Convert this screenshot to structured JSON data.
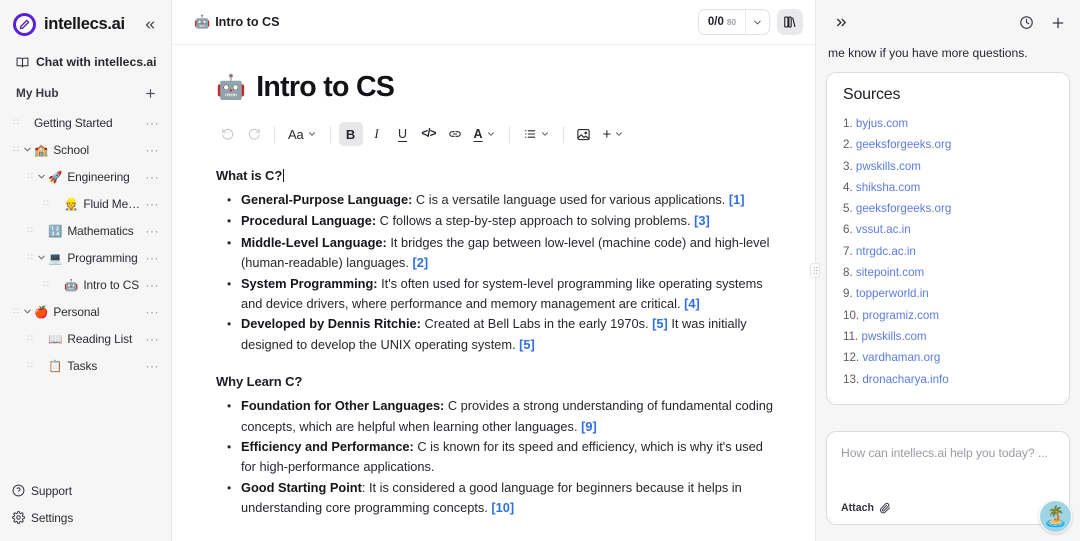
{
  "brand": {
    "name": "intellecs.ai",
    "accent": "#5b21d6",
    "logo_icon": "pen-circle-icon"
  },
  "sidebar": {
    "collapse_icon": "chevrons-left-icon",
    "chat_entry": {
      "label": "Chat with intellecs.ai",
      "icon": "book-open-icon"
    },
    "hub": {
      "label": "My Hub",
      "add_icon": "plus-icon"
    },
    "more_glyph": "···",
    "grip_glyph": "∷",
    "items": [
      {
        "label": "Getting Started",
        "emoji": "",
        "indent": 0,
        "caret": "none"
      },
      {
        "label": "School",
        "emoji": "🏫",
        "indent": 0,
        "caret": "down"
      },
      {
        "label": "Engineering",
        "emoji": "🚀",
        "indent": 1,
        "caret": "down"
      },
      {
        "label": "Fluid Mech...",
        "emoji": "👷",
        "indent": 2,
        "caret": "none"
      },
      {
        "label": "Mathematics",
        "emoji": "🔢",
        "indent": 1,
        "caret": "none"
      },
      {
        "label": "Programming",
        "emoji": "💻",
        "indent": 1,
        "caret": "down"
      },
      {
        "label": "Intro to CS",
        "emoji": "🤖",
        "indent": 2,
        "caret": "none"
      },
      {
        "label": "Personal",
        "emoji": "🍎",
        "indent": 0,
        "caret": "down"
      },
      {
        "label": "Reading List",
        "emoji": "📖",
        "indent": 1,
        "caret": "none"
      },
      {
        "label": "Tasks",
        "emoji": "📋",
        "indent": 1,
        "caret": "none"
      }
    ],
    "bottom": [
      {
        "label": "Support",
        "icon": "help-circle-icon"
      },
      {
        "label": "Settings",
        "icon": "gear-icon"
      }
    ]
  },
  "editor": {
    "breadcrumb": {
      "emoji": "🤖",
      "label": "Intro to CS"
    },
    "count_pill": {
      "value": "0/0",
      "sub": "80",
      "caret_icon": "chevron-down-icon"
    },
    "library_icon": "library-books-icon",
    "doc": {
      "emoji": "🤖",
      "title": "Intro to CS",
      "sections": [
        {
          "heading": "What is C?",
          "cursor": true,
          "bullets": [
            {
              "term": "General-Purpose Language:",
              "text": " C is a versatile language used for various applications. ",
              "cites": [
                "[1]"
              ]
            },
            {
              "term": "Procedural Language:",
              "text": " C follows a step-by-step approach to solving problems. ",
              "cites": [
                "[3]"
              ]
            },
            {
              "term": "Middle-Level Language:",
              "text": " It bridges the gap between low-level (machine code) and high-level (human-readable) languages. ",
              "cites": [
                "[2]"
              ]
            },
            {
              "term": "System Programming:",
              "text": " It's often used for system-level programming like operating systems and device drivers, where performance and memory management are critical. ",
              "cites": [
                "[4]"
              ]
            },
            {
              "term": "Developed by Dennis Ritchie:",
              "text": " Created at Bell Labs in the early 1970s. ",
              "cites": [
                "[5]"
              ],
              "text2": " It was initially designed to develop the UNIX operating system. ",
              "cites2": [
                "[5]"
              ]
            }
          ]
        },
        {
          "heading": "Why Learn C?",
          "cursor": false,
          "bullets": [
            {
              "term": "Foundation for Other Languages:",
              "text": " C provides a strong understanding of fundamental coding concepts, which are helpful when learning other languages. ",
              "cites": [
                "[9]"
              ]
            },
            {
              "term": "Efficiency and Performance:",
              "text": " C is known for its speed and efficiency, which is why it's used for high-performance applications.",
              "cites": []
            },
            {
              "term": "Good Starting Point",
              "text": ": It is considered a good language for beginners because it helps in understanding core programming concepts. ",
              "cites": [
                "[10]"
              ]
            }
          ]
        }
      ]
    },
    "toolbar": {
      "undo_label": "undo-icon",
      "redo_label": "redo-icon",
      "font_label": "Aa",
      "bold_label": "B",
      "italic_label": "I",
      "underline_label": "U",
      "code_label": "</>",
      "link_label": "link-icon",
      "color_label": "A",
      "list_label": "list-icon",
      "image_label": "image-icon",
      "plus_label": "+"
    },
    "resizer_glyph": "⋮⋮"
  },
  "chat": {
    "expand_icon": "chevrons-right-icon",
    "history_icon": "clock-icon",
    "new_icon": "plus-icon",
    "message_tail": "me know if you have more questions.",
    "sources_title": "Sources",
    "sources": [
      "byjus.com",
      "geeksforgeeks.org",
      "pwskills.com",
      "shiksha.com",
      "geeksforgeeks.org",
      "vssut.ac.in",
      "ntrgdc.ac.in",
      "sitepoint.com",
      "topperworld.in",
      "programiz.com",
      "pwskills.com",
      "vardhaman.org",
      "dronacharya.info"
    ],
    "composer_placeholder": "How can intellecs.ai help you today? ...",
    "attach_label": "Attach",
    "attach_icon": "paperclip-icon",
    "avatar_emoji": "🏝️"
  }
}
